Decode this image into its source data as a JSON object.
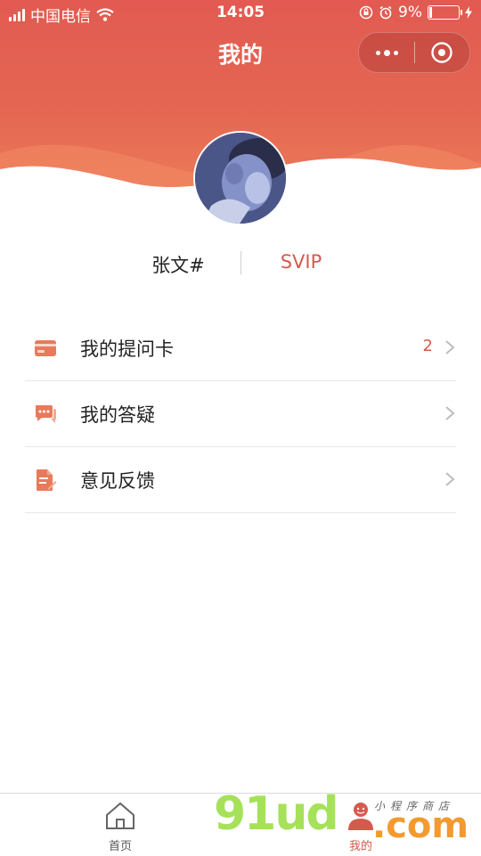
{
  "status_bar": {
    "carrier": "中国电信",
    "time": "14:05",
    "battery": "9%"
  },
  "nav": {
    "title": "我的"
  },
  "profile": {
    "name": "张文#",
    "level": "SVIP"
  },
  "menu": {
    "items": [
      {
        "label": "我的提问卡",
        "count": "2",
        "icon": "card-icon"
      },
      {
        "label": "我的答疑",
        "count": "",
        "icon": "chat-icon"
      },
      {
        "label": "意见反馈",
        "count": "",
        "icon": "document-edit-icon"
      }
    ]
  },
  "tabbar": {
    "home": "首页",
    "mine": "我的"
  },
  "watermark": {
    "brand": "91ud",
    "tld": ".com",
    "tagline": "小程序商店"
  },
  "colors": {
    "header_top": "#e25a52",
    "header_bottom": "#ee7e5a",
    "accent": "#d55a4e"
  }
}
